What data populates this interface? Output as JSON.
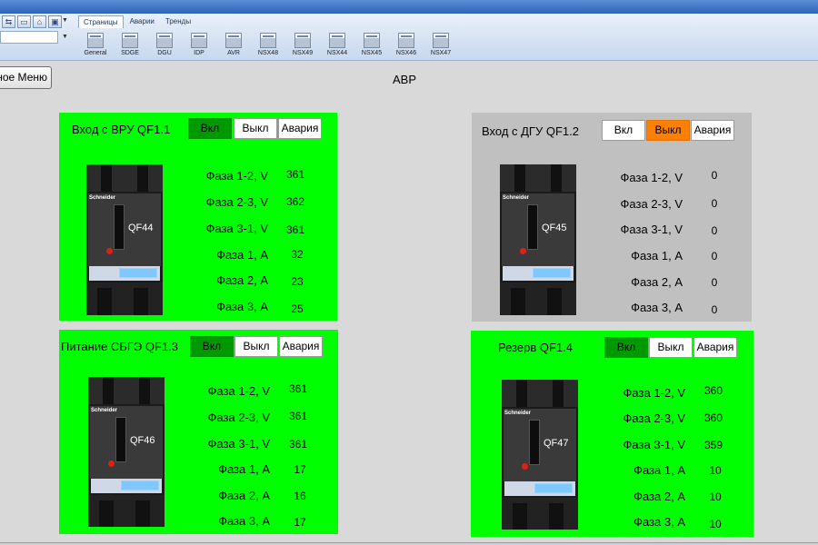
{
  "ribbon": {
    "tabs": [
      "Страницы",
      "Аварии",
      "Тренды"
    ],
    "pages": [
      "General",
      "SDGE",
      "DGU",
      "IDP",
      "AVR",
      "NSX48",
      "NSX49",
      "NSX44",
      "NSX45",
      "NSX46",
      "NSX47"
    ]
  },
  "header": {
    "menu_label": "ное Меню",
    "title": "АВР"
  },
  "panels": [
    {
      "title": "Вход с ВРУ QF1.1",
      "state": "on",
      "buttons": [
        "Вкл",
        "Выкл",
        "Авария"
      ],
      "breaker_label": "QF44",
      "breaker_brand": "Schneider",
      "rows": [
        {
          "label": "Фаза 1-2, V",
          "value": "361"
        },
        {
          "label": "Фаза 2-3, V",
          "value": "362"
        },
        {
          "label": "Фаза 3-1, V",
          "value": "361"
        },
        {
          "label": "Фаза 1, А",
          "value": "32"
        },
        {
          "label": "Фаза 2, А",
          "value": "23"
        },
        {
          "label": "Фаза 3, А",
          "value": "25"
        }
      ]
    },
    {
      "title": "Вход с ДГУ QF1.2",
      "state": "off",
      "buttons": [
        "Вкл",
        "Выкл",
        "Авария"
      ],
      "breaker_label": "QF45",
      "breaker_brand": "Schneider",
      "rows": [
        {
          "label": "Фаза 1-2, V",
          "value": "0"
        },
        {
          "label": "Фаза 2-3, V",
          "value": "0"
        },
        {
          "label": "Фаза 3-1, V",
          "value": "0"
        },
        {
          "label": "Фаза 1, А",
          "value": "0"
        },
        {
          "label": "Фаза 2, А",
          "value": "0"
        },
        {
          "label": "Фаза 3, А",
          "value": "0"
        }
      ]
    },
    {
      "title": "Питание СБГЭ QF1.3",
      "state": "on",
      "buttons": [
        "Вкл",
        "Выкл",
        "Авария"
      ],
      "breaker_label": "QF46",
      "breaker_brand": "Schneider",
      "rows": [
        {
          "label": "Фаза 1-2, V",
          "value": "361"
        },
        {
          "label": "Фаза 2-3, V",
          "value": "361"
        },
        {
          "label": "Фаза 3-1, V",
          "value": "361"
        },
        {
          "label": "Фаза 1, А",
          "value": "17"
        },
        {
          "label": "Фаза 2, А",
          "value": "16"
        },
        {
          "label": "Фаза 3, А",
          "value": "17"
        }
      ]
    },
    {
      "title": "Резерв QF1.4",
      "state": "on",
      "buttons": [
        "Вкл",
        "Выкл",
        "Авария"
      ],
      "breaker_label": "QF47",
      "breaker_brand": "Schneider",
      "rows": [
        {
          "label": "Фаза 1-2, V",
          "value": "360"
        },
        {
          "label": "Фаза 2-3, V",
          "value": "360"
        },
        {
          "label": "Фаза 3-1, V",
          "value": "359"
        },
        {
          "label": "Фаза 1, А",
          "value": "10"
        },
        {
          "label": "Фаза 2, А",
          "value": "10"
        },
        {
          "label": "Фаза 3, А",
          "value": "10"
        }
      ]
    }
  ],
  "colors": {
    "panel_on": "#00ff00",
    "panel_off": "#c0c0c0",
    "button_on_active": "#009a00",
    "button_off_active": "#ff7f00"
  }
}
